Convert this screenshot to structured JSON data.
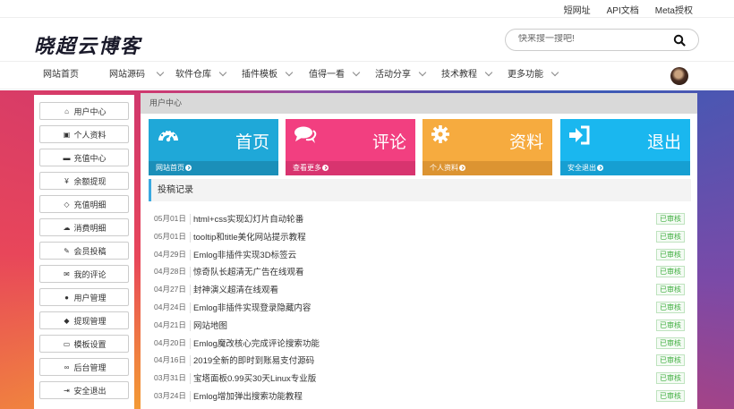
{
  "toplinks": [
    "短网址",
    "API文档",
    "Meta授权"
  ],
  "logo": "晓超云博客",
  "search": {
    "placeholder": "快来搜一搜吧!"
  },
  "nav": [
    "网站首页",
    "网站源码",
    "软件仓库",
    "插件模板",
    "值得一看",
    "活动分享",
    "技术教程",
    "更多功能"
  ],
  "sidebar": [
    {
      "icon": "home-icon",
      "glyph": "⌂",
      "label": "用户中心"
    },
    {
      "icon": "id-card-icon",
      "glyph": "▣",
      "label": "个人资料"
    },
    {
      "icon": "credit-card-icon",
      "glyph": "▬",
      "label": "充值中心"
    },
    {
      "icon": "yen-icon",
      "glyph": "¥",
      "label": "余额提现"
    },
    {
      "icon": "diamond-icon",
      "glyph": "◇",
      "label": "充值明细"
    },
    {
      "icon": "cloud-icon",
      "glyph": "☁",
      "label": "消费明细"
    },
    {
      "icon": "edit-icon",
      "glyph": "✎",
      "label": "会员投稿"
    },
    {
      "icon": "comments-icon",
      "glyph": "✉",
      "label": "我的评论"
    },
    {
      "icon": "user-icon",
      "glyph": "●",
      "label": "用户管理"
    },
    {
      "icon": "cube-icon",
      "glyph": "◆",
      "label": "提现管理"
    },
    {
      "icon": "desktop-icon",
      "glyph": "▭",
      "label": "模板设置"
    },
    {
      "icon": "link-icon",
      "glyph": "∞",
      "label": "后台管理"
    },
    {
      "icon": "sign-out-icon",
      "glyph": "⇥",
      "label": "安全退出"
    }
  ],
  "breadcrumb": "用户中心",
  "cards": [
    {
      "title": "首页",
      "link": "网站首页",
      "color": "#1fa8d8",
      "foot_color": "#1b8fb9",
      "icon": "dashboard-icon"
    },
    {
      "title": "评论",
      "link": "查看更多",
      "color": "#f23f80",
      "foot_color": "#d8346f",
      "icon": "comments-icon"
    },
    {
      "title": "资料",
      "link": "个人资料",
      "color": "#f6ab3f",
      "foot_color": "#dc9432",
      "icon": "gear-icon"
    },
    {
      "title": "退出",
      "link": "安全退出",
      "color": "#1ab7ef",
      "foot_color": "#169fd2",
      "icon": "sign-in-icon"
    }
  ],
  "section_title": "投稿记录",
  "posts": [
    {
      "date": "05月01日",
      "title": "html+css实现幻灯片自动轮番",
      "status": "已审核"
    },
    {
      "date": "05月01日",
      "title": "tooltip和title美化网站提示教程",
      "status": "已审核"
    },
    {
      "date": "04月29日",
      "title": "Emlog非插件实现3D标签云",
      "status": "已审核"
    },
    {
      "date": "04月28日",
      "title": "惊奇队长超清无广告在线观看",
      "status": "已审核"
    },
    {
      "date": "04月27日",
      "title": "封神演义超清在线观看",
      "status": "已审核"
    },
    {
      "date": "04月24日",
      "title": "Emlog非插件实现登录隐藏内容",
      "status": "已审核"
    },
    {
      "date": "04月21日",
      "title": "网站地图",
      "status": "已审核"
    },
    {
      "date": "04月20日",
      "title": "Emlog魔改核心完成评论搜索功能",
      "status": "已审核"
    },
    {
      "date": "04月16日",
      "title": "2019全新的即时到账易支付源码",
      "status": "已审核"
    },
    {
      "date": "03月31日",
      "title": "宝塔面板0.99买30天Linux专业版",
      "status": "已审核"
    },
    {
      "date": "03月24日",
      "title": "Emlog增加弹出搜索功能教程",
      "status": "已审核"
    }
  ]
}
